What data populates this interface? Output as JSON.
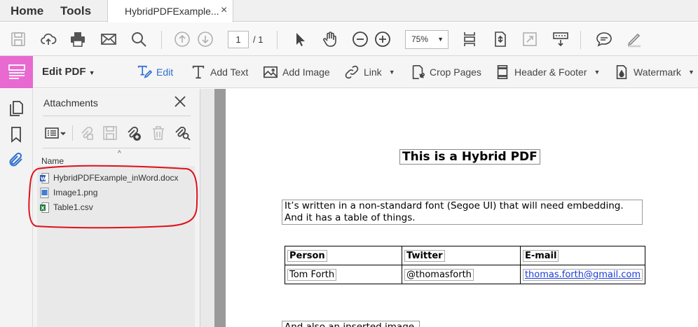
{
  "menu": {
    "home": "Home",
    "tools": "Tools"
  },
  "document_tab": {
    "title": "HybridPDFExample...",
    "close": "×"
  },
  "toolbar": {
    "page_current": "1",
    "page_total": "/ 1",
    "zoom": "75%",
    "icons": [
      "save-icon",
      "upload-cloud-icon",
      "print-icon",
      "email-icon",
      "search-icon",
      "page-up-icon",
      "page-down-icon",
      "select-pointer-icon",
      "hand-icon",
      "zoom-out-icon",
      "zoom-in-icon",
      "scroll-mode-icon",
      "fit-page-icon",
      "full-screen-icon",
      "keyboard-tools-icon",
      "comment-icon",
      "sign-icon"
    ]
  },
  "edit_bar": {
    "title": "Edit PDF",
    "tools": {
      "edit": "Edit",
      "add_text": "Add Text",
      "add_image": "Add Image",
      "link": "Link",
      "crop_pages": "Crop Pages",
      "header_footer": "Header & Footer",
      "watermark": "Watermark"
    }
  },
  "attachments": {
    "title": "Attachments",
    "column_header": "Name",
    "files": [
      {
        "name": "HybridPDFExample_inWord.docx",
        "icon": "word-file-icon"
      },
      {
        "name": "Image1.png",
        "icon": "image-file-icon"
      },
      {
        "name": "Table1.csv",
        "icon": "excel-file-icon"
      }
    ]
  },
  "document": {
    "title": "This is a Hybrid PDF",
    "paragraph": "It’s written in a non-standard font (Segoe UI) that will need embedding. And it has a table of things.",
    "table": {
      "headers": [
        "Person",
        "Twitter",
        "E-mail"
      ],
      "rows": [
        [
          "Tom Forth",
          "@thomasforth",
          "thomas.forth@gmail.com"
        ]
      ]
    },
    "footer_text": "And also an inserted image."
  },
  "colors": {
    "edit_accent": "#e86ad0",
    "active_tool": "#2c6fd0",
    "annotation_red": "#e0101a",
    "link": "#1a3ad6"
  }
}
